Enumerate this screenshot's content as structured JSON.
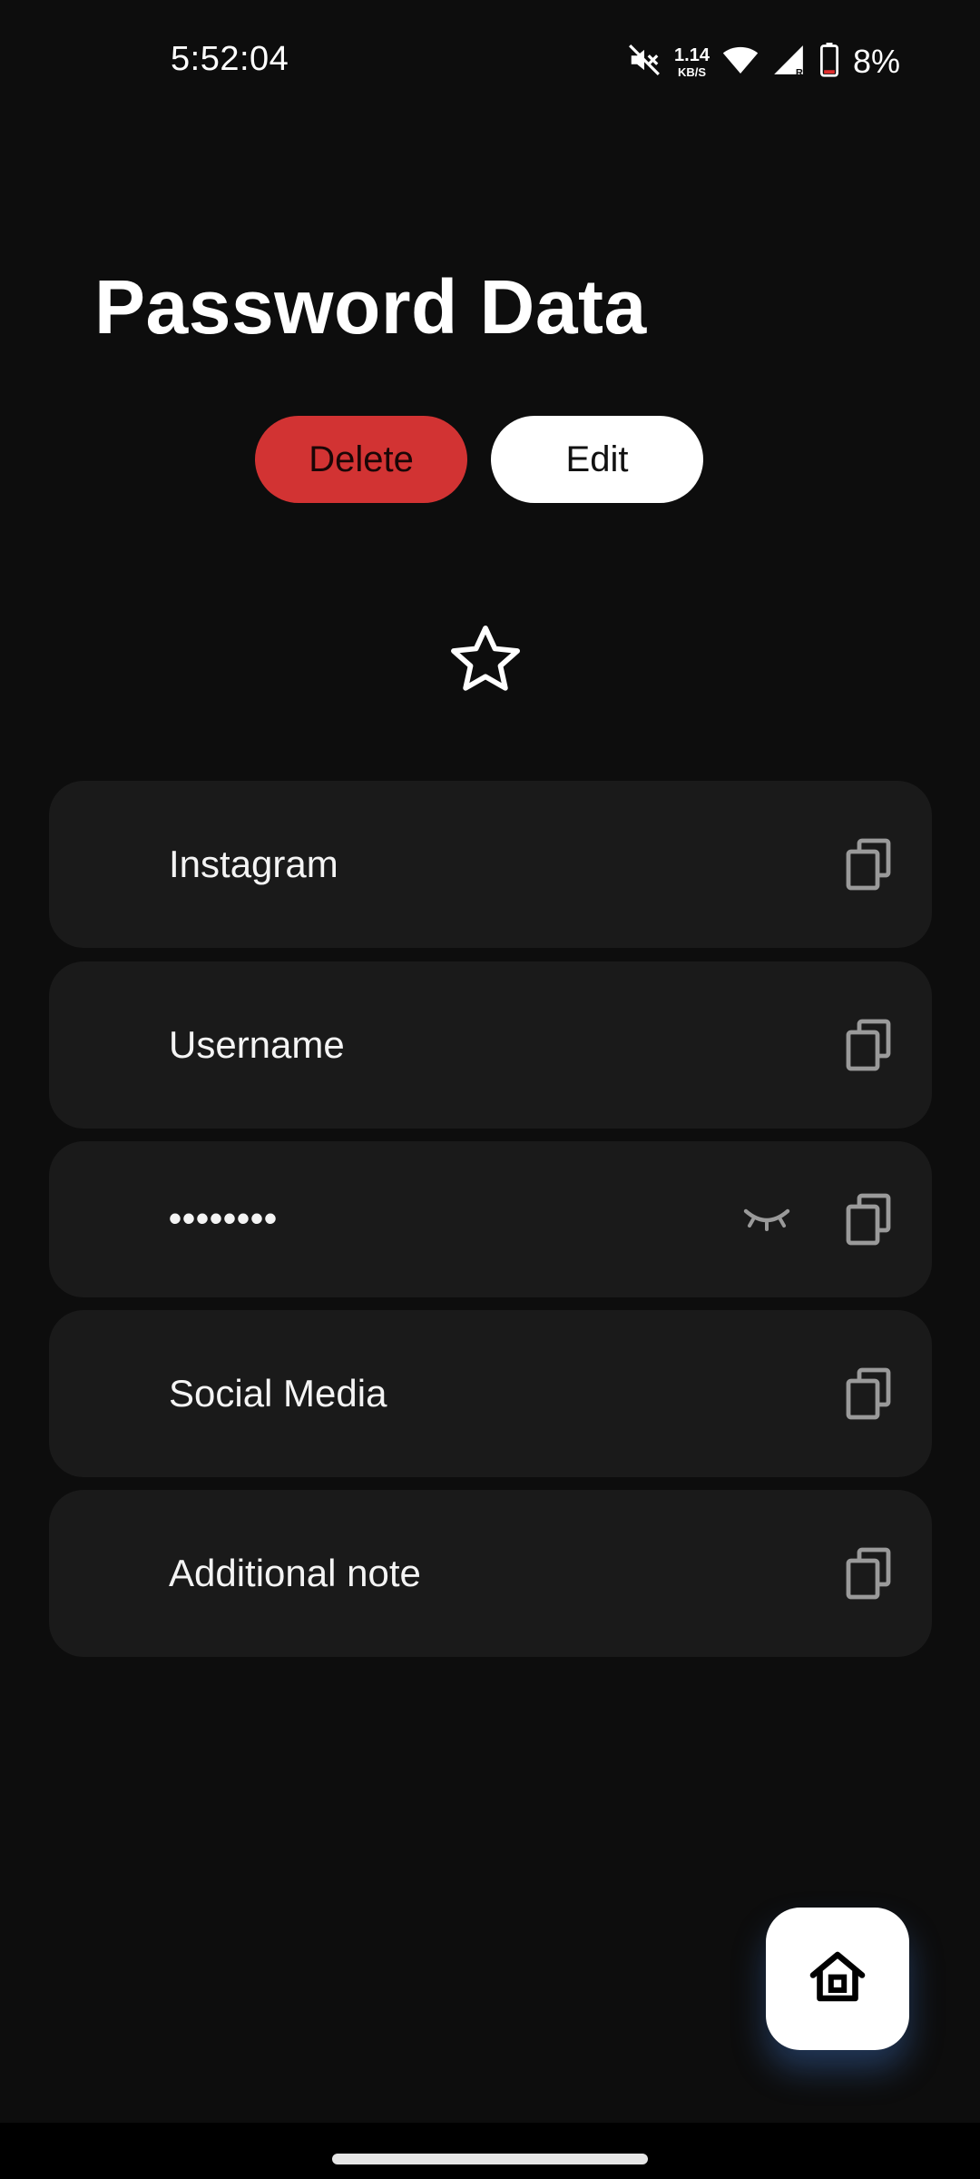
{
  "status_bar": {
    "time": "5:52:04",
    "net_speed_value": "1.14",
    "net_speed_unit": "KB/S",
    "battery_percent": "8%",
    "icons": [
      "mute-icon",
      "wifi-icon",
      "signal-icon",
      "battery-icon"
    ]
  },
  "page": {
    "title": "Password Data"
  },
  "actions": {
    "delete_label": "Delete",
    "edit_label": "Edit"
  },
  "favorite": {
    "icon": "star-outline-icon",
    "selected": false
  },
  "fields": [
    {
      "label": "Instagram"
    },
    {
      "label": "Username"
    },
    {
      "value": "••••••••",
      "masked": true
    },
    {
      "label": "Social Media"
    },
    {
      "label": "Additional note"
    }
  ],
  "fab": {
    "icon": "home-icon"
  },
  "colors": {
    "background": "#0d0d0d",
    "card": "#1a1a1a",
    "delete": "#d23333",
    "edit": "#ffffff",
    "icon_gray": "#9a9a9a"
  }
}
